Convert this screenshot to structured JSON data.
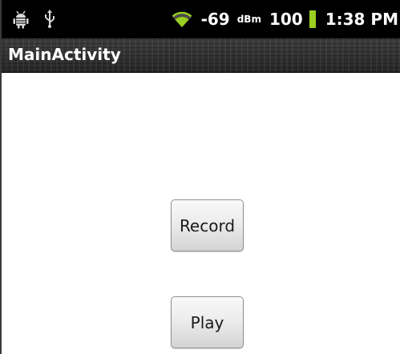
{
  "status_bar": {
    "icons": [
      "android-debug-icon",
      "usb-icon",
      "wifi-icon"
    ],
    "signal_value": "-69",
    "signal_unit": "dBm",
    "battery_value": "100",
    "battery_color": "#9ace21",
    "wifi_color": "#9ace21",
    "time": "1:38 PM"
  },
  "title_bar": {
    "title": "MainActivity"
  },
  "main": {
    "record_label": "Record",
    "play_label": "Play"
  }
}
